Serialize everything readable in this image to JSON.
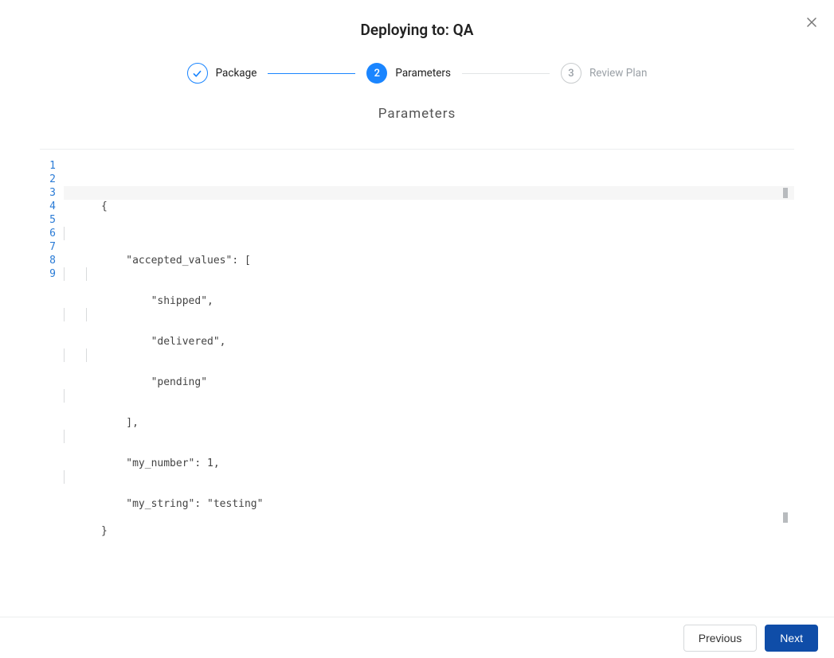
{
  "header": {
    "title": "Deploying to: QA"
  },
  "stepper": {
    "steps": [
      {
        "label": "Package",
        "status": "completed"
      },
      {
        "label": "Parameters",
        "status": "active",
        "num": "2"
      },
      {
        "label": "Review Plan",
        "status": "pending",
        "num": "3"
      }
    ]
  },
  "section_title": "Parameters",
  "code": {
    "line_numbers": [
      "1",
      "2",
      "3",
      "4",
      "5",
      "6",
      "7",
      "8",
      "9"
    ],
    "lines": [
      "{",
      "    \"accepted_values\": [",
      "        \"shipped\",",
      "        \"delivered\",",
      "        \"pending\"",
      "    ],",
      "    \"my_number\": 1,",
      "    \"my_string\": \"testing\"",
      "}"
    ]
  },
  "footer": {
    "previous_label": "Previous",
    "next_label": "Next"
  }
}
